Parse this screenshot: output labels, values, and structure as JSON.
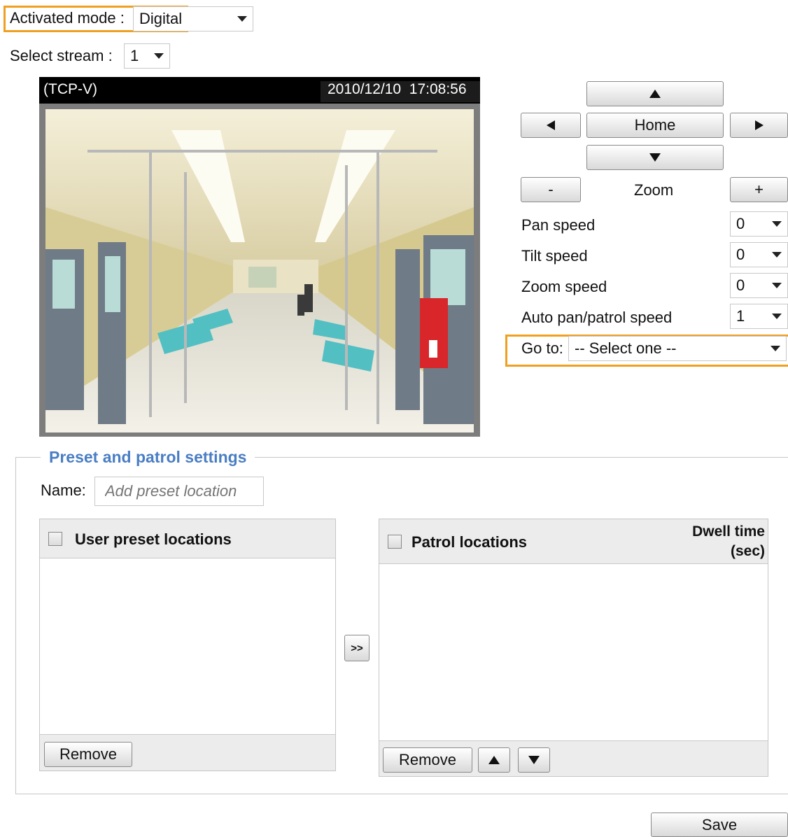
{
  "top": {
    "activated_mode_label": "Activated mode :",
    "activated_mode_value": "Digital",
    "select_stream_label": "Select stream :",
    "select_stream_value": "1"
  },
  "video": {
    "protocol": "(TCP-V)",
    "timestamp": "2010/12/10  17:08:56"
  },
  "ptz": {
    "home_label": "Home",
    "zoom_label": "Zoom",
    "zoom_out_label": "-",
    "zoom_in_label": "+",
    "pan_speed_label": "Pan speed",
    "pan_speed_value": "0",
    "tilt_speed_label": "Tilt speed",
    "tilt_speed_value": "0",
    "zoom_speed_label": "Zoom speed",
    "zoom_speed_value": "0",
    "auto_pan_label": "Auto pan/patrol speed",
    "auto_pan_value": "1",
    "goto_label": "Go to:",
    "goto_value": "-- Select one --"
  },
  "preset": {
    "legend": "Preset and patrol settings",
    "name_label": "Name:",
    "name_placeholder": "Add preset location",
    "user_list_title": "User preset locations",
    "patrol_list_title": "Patrol locations",
    "dwell_time_line1": "Dwell time",
    "dwell_time_line2": "(sec)",
    "transfer_label": ">>",
    "remove_label": "Remove",
    "patrol_remove_label": "Remove"
  },
  "footer": {
    "save_label": "Save"
  },
  "colors": {
    "highlight": "#f0a020",
    "legend_blue": "#4a7ec4",
    "video_bar": "#000000"
  }
}
